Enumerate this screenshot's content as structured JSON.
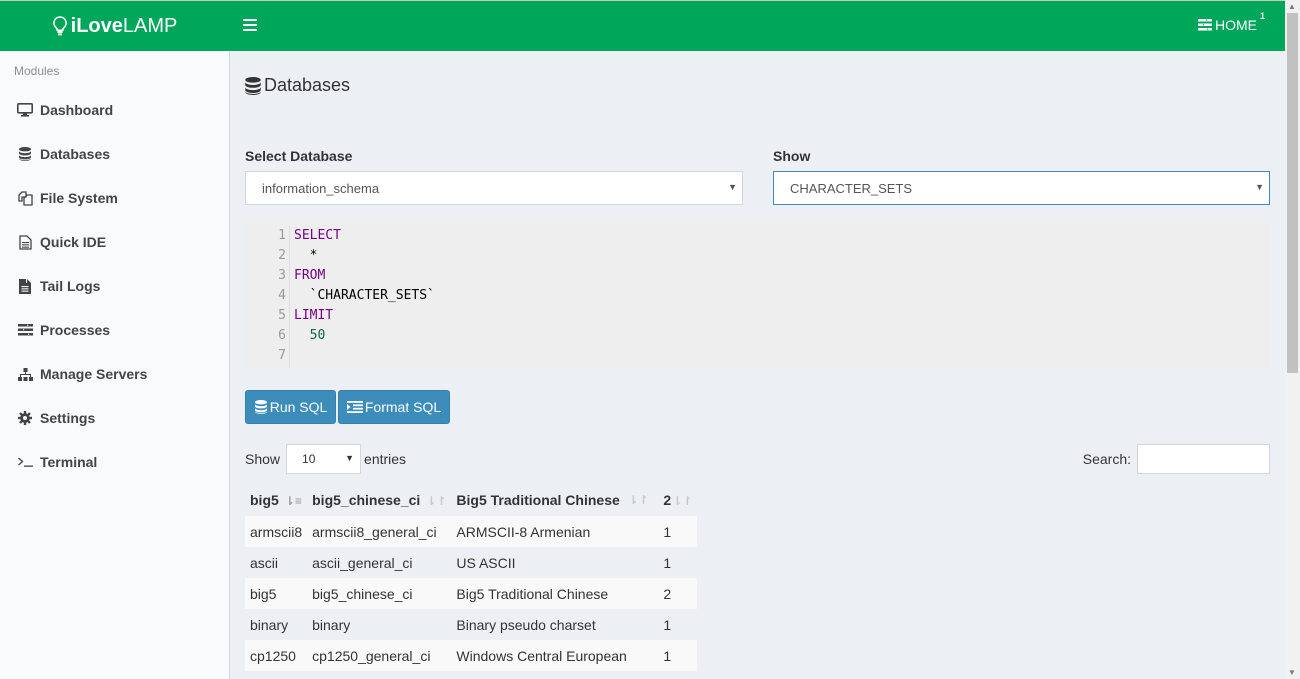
{
  "brand": {
    "bold": "iLove",
    "light": "LAMP"
  },
  "navbar": {
    "home_label": "HOME",
    "home_badge": "1"
  },
  "sidebar": {
    "header": "Modules",
    "items": [
      {
        "label": "Dashboard",
        "icon": "desktop-icon"
      },
      {
        "label": "Databases",
        "icon": "database-icon"
      },
      {
        "label": "File System",
        "icon": "files-icon"
      },
      {
        "label": "Quick IDE",
        "icon": "file-text-icon"
      },
      {
        "label": "Tail Logs",
        "icon": "file-icon"
      },
      {
        "label": "Processes",
        "icon": "tasks-icon"
      },
      {
        "label": "Manage Servers",
        "icon": "sitemap-icon"
      },
      {
        "label": "Settings",
        "icon": "gear-icon"
      },
      {
        "label": "Terminal",
        "icon": "terminal-icon"
      }
    ]
  },
  "page": {
    "title": "Databases"
  },
  "form": {
    "db_label": "Select Database",
    "db_value": "information_schema",
    "show_label": "Show",
    "show_value": "CHARACTER_SETS"
  },
  "editor": {
    "lines": [
      "SELECT",
      "  *",
      "FROM",
      "  `CHARACTER_SETS`",
      "LIMIT",
      "  50",
      ""
    ],
    "line_numbers": [
      "1",
      "2",
      "3",
      "4",
      "5",
      "6",
      "7"
    ]
  },
  "buttons": {
    "run": "Run SQL",
    "format": "Format SQL"
  },
  "datatable": {
    "show_label": "Show",
    "length_value": "10",
    "entries_label": "entries",
    "search_label": "Search:",
    "search_value": "",
    "columns": [
      "big5",
      "big5_chinese_ci",
      "Big5 Traditional Chinese",
      "2"
    ],
    "rows": [
      [
        "armscii8",
        "armscii8_general_ci",
        "ARMSCII-8 Armenian",
        "1"
      ],
      [
        "ascii",
        "ascii_general_ci",
        "US ASCII",
        "1"
      ],
      [
        "big5",
        "big5_chinese_ci",
        "Big5 Traditional Chinese",
        "2"
      ],
      [
        "binary",
        "binary",
        "Binary pseudo charset",
        "1"
      ],
      [
        "cp1250",
        "cp1250_general_ci",
        "Windows Central European",
        "1"
      ]
    ]
  },
  "colors": {
    "navbar": "#00a65a",
    "primary": "#3c8dbc",
    "keyword": "#770088",
    "number": "#116644"
  }
}
